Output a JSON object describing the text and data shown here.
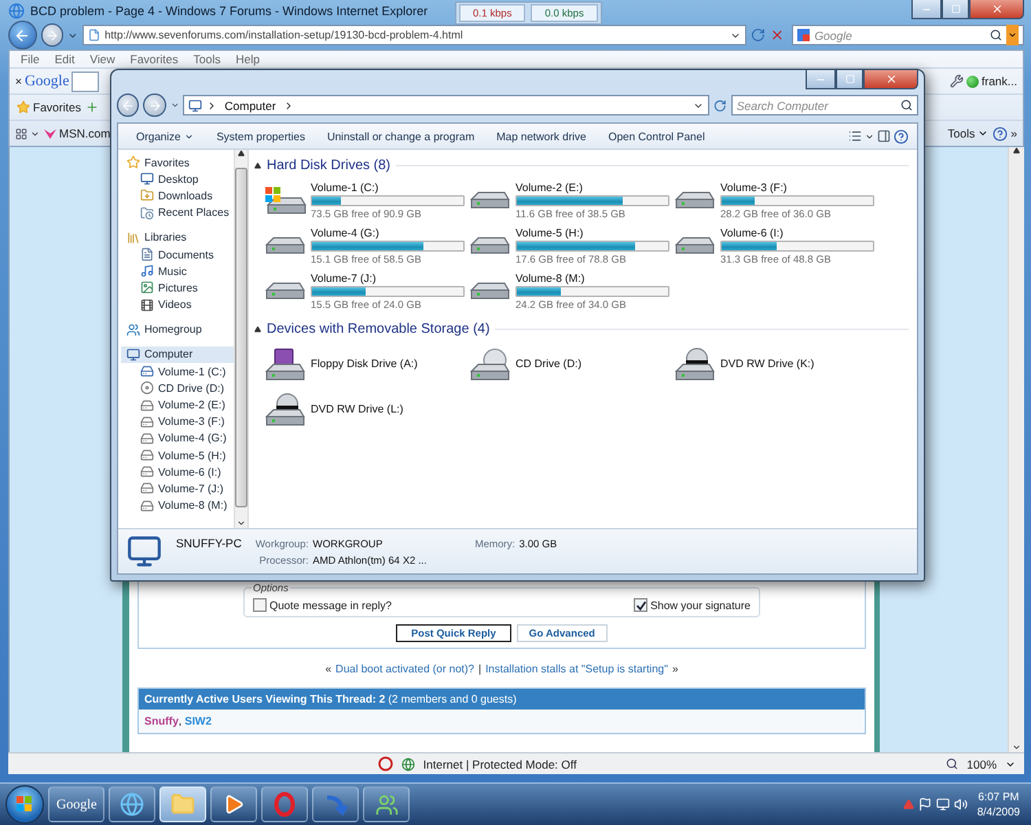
{
  "ie": {
    "title": "BCD problem - Page 4 - Windows 7 Forums - Windows Internet Explorer",
    "address": "http://www.sevenforums.com/installation-setup/19130-bcd-problem-4.html",
    "speed": [
      {
        "label": "0.1 kbps",
        "color": "#b02828"
      },
      {
        "label": "0.0 kbps",
        "color": "#1f6e3e"
      }
    ],
    "search": {
      "placeholder": "Google"
    },
    "menu": [
      "File",
      "Edit",
      "View",
      "Favorites",
      "Tools",
      "Help"
    ],
    "google_toolbar": {
      "close": "×",
      "logo": "Google",
      "account": "frank..."
    },
    "favorites_bar": {
      "favorites": "Favorites",
      "link": "MSN.com"
    },
    "command_bar": {
      "tools": "Tools",
      "more": "»"
    },
    "status": {
      "zone": "Internet | Protected Mode: Off",
      "zoom": "100%"
    }
  },
  "explorer": {
    "address": [
      "Computer"
    ],
    "search": {
      "placeholder": "Search Computer"
    },
    "toolbar": [
      {
        "label": "Organize",
        "menu": true
      },
      {
        "label": "System properties",
        "menu": false
      },
      {
        "label": "Uninstall or change a program",
        "menu": false
      },
      {
        "label": "Map network drive",
        "menu": false
      },
      {
        "label": "Open Control Panel",
        "menu": false
      }
    ],
    "nav": [
      {
        "label": "Favorites",
        "kind": "star",
        "selected": false,
        "children": [
          {
            "label": "Desktop",
            "kind": "desktop",
            "selected": false
          },
          {
            "label": "Downloads",
            "kind": "downloads",
            "selected": false
          },
          {
            "label": "Recent Places",
            "kind": "recent",
            "selected": false
          }
        ]
      },
      {
        "label": "Libraries",
        "kind": "library",
        "selected": false,
        "children": [
          {
            "label": "Documents",
            "kind": "documents",
            "selected": false
          },
          {
            "label": "Music",
            "kind": "music",
            "selected": false
          },
          {
            "label": "Pictures",
            "kind": "pictures",
            "selected": false
          },
          {
            "label": "Videos",
            "kind": "videos",
            "selected": false
          }
        ]
      },
      {
        "label": "Homegroup",
        "kind": "homegroup",
        "selected": false
      },
      {
        "label": "Computer",
        "kind": "computer",
        "selected": true,
        "children": [
          {
            "label": "Volume-1 (C:)",
            "kind": "system",
            "selected": false
          },
          {
            "label": "CD Drive (D:)",
            "kind": "cd",
            "selected": false
          },
          {
            "label": "Volume-2 (E:)",
            "kind": "hdd",
            "selected": false
          },
          {
            "label": "Volume-3 (F:)",
            "kind": "hdd",
            "selected": false
          },
          {
            "label": "Volume-4 (G:)",
            "kind": "hdd",
            "selected": false
          },
          {
            "label": "Volume-5 (H:)",
            "kind": "hdd",
            "selected": false
          },
          {
            "label": "Volume-6 (I:)",
            "kind": "hdd",
            "selected": false
          },
          {
            "label": "Volume-7 (J:)",
            "kind": "hdd",
            "selected": false
          },
          {
            "label": "Volume-8 (M:)",
            "kind": "hdd",
            "selected": false
          }
        ]
      }
    ],
    "sections": [
      {
        "title": "Hard Disk Drives (8)",
        "items": [
          {
            "name": "Volume-1 (C:)",
            "kind": "system",
            "level": 0.19,
            "free": "73.5 GB free of 90.9 GB"
          },
          {
            "name": "Volume-2 (E:)",
            "kind": "hdd",
            "level": 0.7,
            "free": "11.6 GB free of 38.5 GB"
          },
          {
            "name": "Volume-3 (F:)",
            "kind": "hdd",
            "level": 0.22,
            "free": "28.2 GB free of 36.0 GB"
          },
          {
            "name": "Volume-4 (G:)",
            "kind": "hdd",
            "level": 0.74,
            "free": "15.1 GB free of 58.5 GB"
          },
          {
            "name": "Volume-5 (H:)",
            "kind": "hdd",
            "level": 0.78,
            "free": "17.6 GB free of 78.8 GB"
          },
          {
            "name": "Volume-6 (I:)",
            "kind": "hdd",
            "level": 0.36,
            "free": "31.3 GB free of 48.8 GB"
          },
          {
            "name": "Volume-7 (J:)",
            "kind": "hdd",
            "level": 0.35,
            "free": "15.5 GB free of 24.0 GB"
          },
          {
            "name": "Volume-8 (M:)",
            "kind": "hdd",
            "level": 0.29,
            "free": "24.2 GB free of 34.0 GB"
          }
        ]
      },
      {
        "title": "Devices with Removable Storage (4)",
        "items": [
          {
            "name": "Floppy Disk Drive (A:)",
            "kind": "floppy"
          },
          {
            "name": "CD Drive (D:)",
            "kind": "cd"
          },
          {
            "name": "DVD RW Drive (K:)",
            "kind": "dvd"
          },
          {
            "name": "DVD RW Drive (L:)",
            "kind": "dvd"
          }
        ]
      }
    ],
    "details": {
      "name": "SNUFFY-PC",
      "fields": [
        {
          "label": "Workgroup:",
          "value": "WORKGROUP"
        },
        {
          "label": "Memory:",
          "value": "3.00 GB"
        },
        {
          "label": "Processor:",
          "value": "AMD Athlon(tm) 64 X2 ..."
        }
      ]
    }
  },
  "forum": {
    "options": {
      "legend": "Options",
      "checkboxes": [
        {
          "label": "Quote message in reply?",
          "checked": false
        },
        {
          "label": "Show your signature",
          "checked": true
        }
      ]
    },
    "buttons": [
      "Post Quick Reply",
      "Go Advanced"
    ],
    "thread_nav": {
      "prev_mark": "«",
      "prev": "Dual boot activated (or not)?",
      "separator": "|",
      "next": "Installation stalls at \"Setup is starting\"",
      "next_mark": "»"
    },
    "active_users": {
      "header": "**Currently Active Users Viewing This Thread: 2** (2 members and 0 guests)",
      "separator": ",",
      "users": [
        {
          "name": "Snuffy",
          "color": "#b5408e"
        },
        {
          "name": "SIW2",
          "color": "#2a8ad8"
        }
      ]
    }
  },
  "taskbar": {
    "apps": [
      {
        "kind": "google",
        "label": "Google",
        "selected": false
      },
      {
        "kind": "ie",
        "selected": false
      },
      {
        "kind": "explorer",
        "selected": true
      },
      {
        "kind": "media",
        "selected": false
      },
      {
        "kind": "opera",
        "selected": false
      },
      {
        "kind": "arrow",
        "selected": false
      },
      {
        "kind": "people",
        "selected": false
      }
    ],
    "time": "6:07 PM",
    "date": "8/4/2009"
  }
}
